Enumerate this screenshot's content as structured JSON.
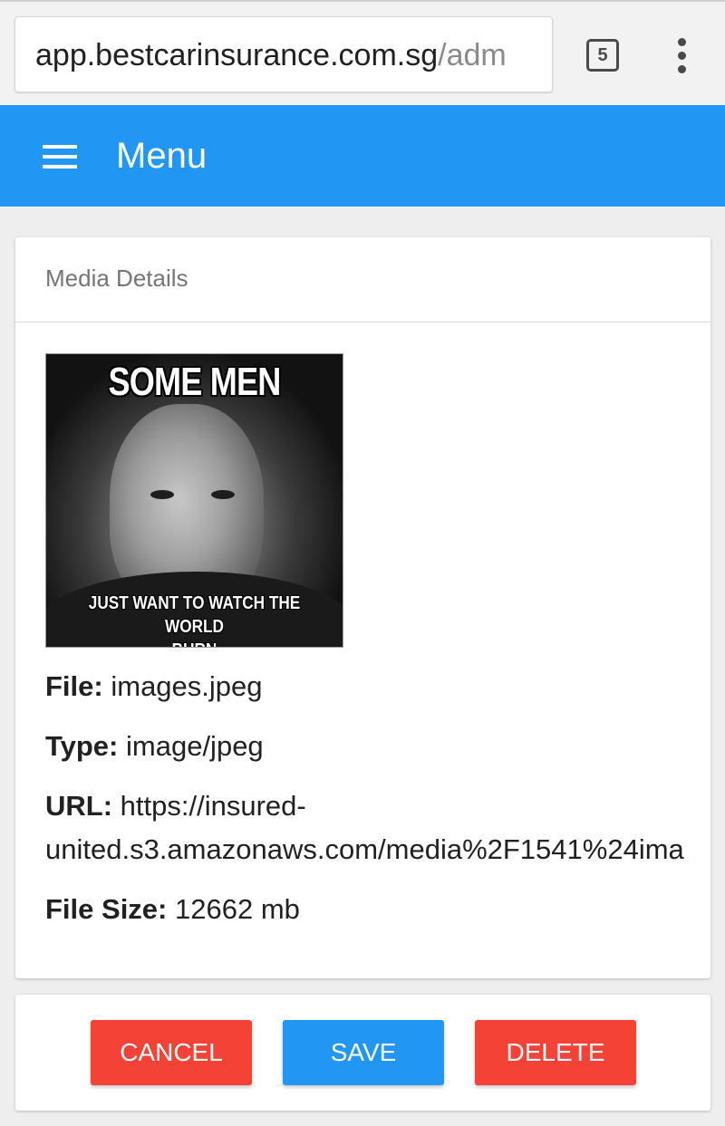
{
  "browser": {
    "url_host": "app.bestcarinsurance.com.sg",
    "url_path": "/adm",
    "tab_count": "5"
  },
  "app_bar": {
    "menu_icon": "hamburger-menu-icon",
    "title": "Menu",
    "color": "#2196f3"
  },
  "card": {
    "header": "Media Details",
    "image": {
      "top_caption": "SOME MEN",
      "bottom_caption_line1": "JUST WANT TO WATCH THE WORLD",
      "bottom_caption_line2": "BURN"
    },
    "details": {
      "file_label": "File:",
      "file_value": "images.jpeg",
      "type_label": "Type:",
      "type_value": "image/jpeg",
      "url_label": "URL:",
      "url_value_line1": "https://insured-",
      "url_value_line2": "united.s3.amazonaws.com/media%2F1541%24ima",
      "size_label": "File Size:",
      "size_value": "12662 mb"
    }
  },
  "actions": {
    "cancel_label": "CANCEL",
    "save_label": "SAVE",
    "delete_label": "DELETE",
    "danger_color": "#f44336",
    "primary_color": "#2196f3"
  }
}
